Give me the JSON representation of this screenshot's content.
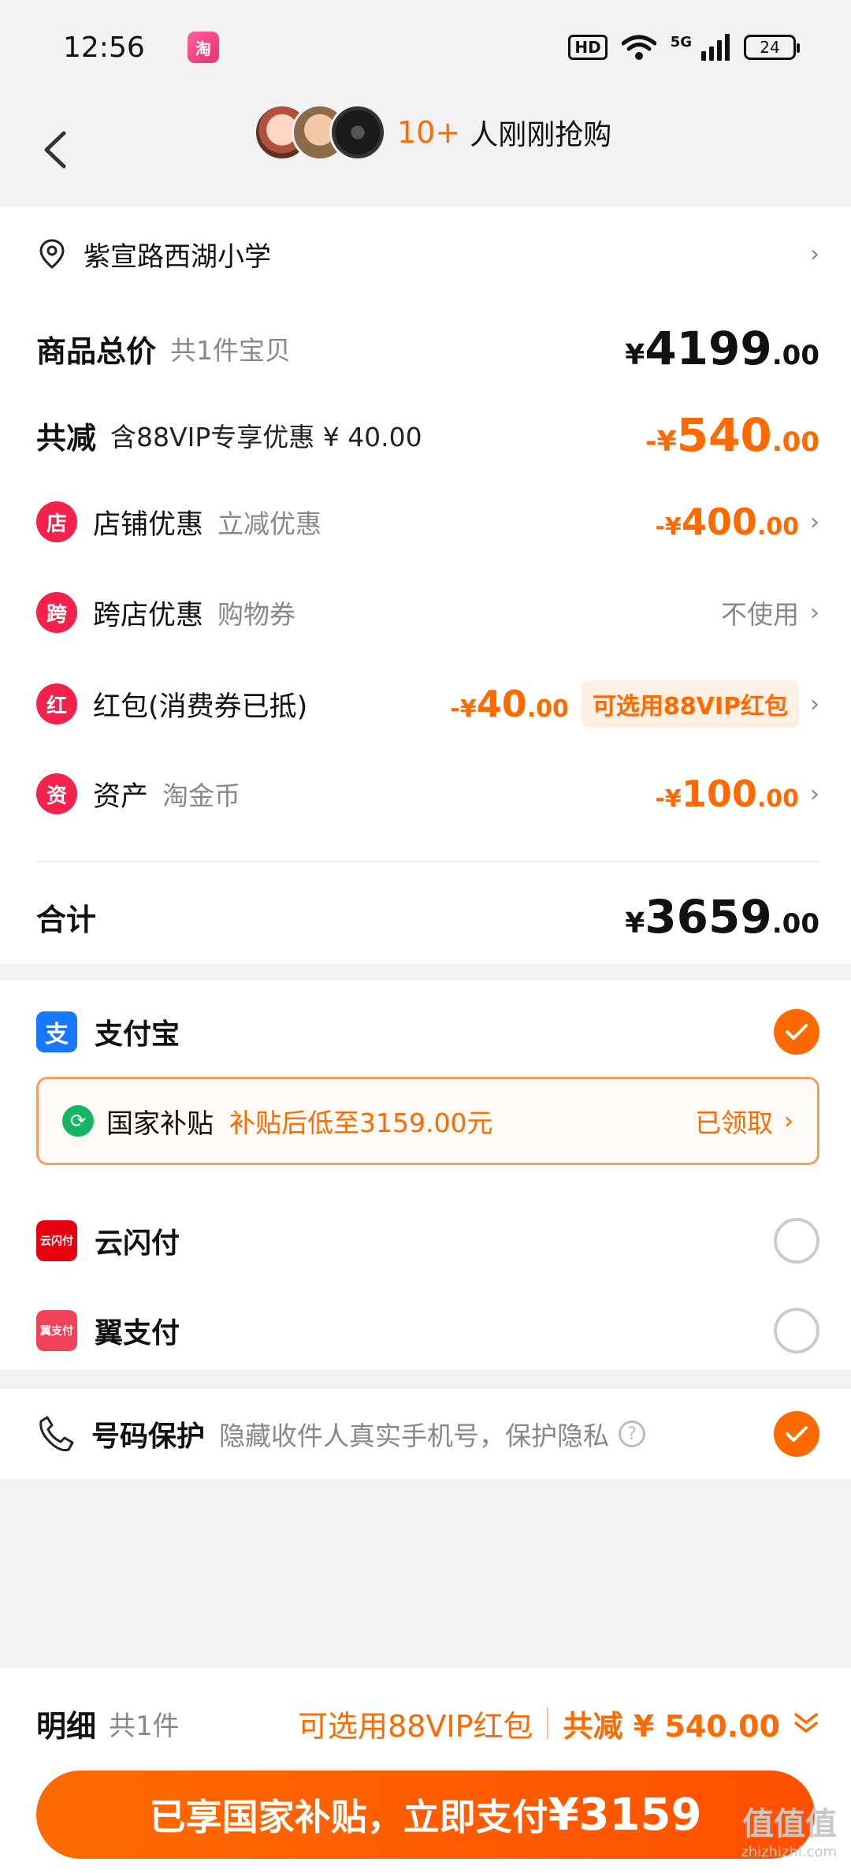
{
  "status_bar": {
    "time": "12:56",
    "app_icon_label": "淘",
    "hd": "HD",
    "network": "5G",
    "battery": "24"
  },
  "header": {
    "count": "10+",
    "text": "人刚刚抢购"
  },
  "address": {
    "text": "紫宣路西湖小学"
  },
  "summary": {
    "total_label": "商品总价",
    "total_sub": "共1件宝贝",
    "total_cur": "¥",
    "total_int": "4199",
    "total_dec": ".00",
    "reduce_label": "共减",
    "reduce_sub": "含88VIP专享优惠 ¥ 40.00",
    "reduce_cur": "-¥",
    "reduce_int": "540",
    "reduce_dec": ".00"
  },
  "discounts": [
    {
      "icon": "店",
      "label": "店铺优惠",
      "sub": "立减优惠",
      "cur": "-¥",
      "int": "400",
      "dec": ".00"
    },
    {
      "icon": "跨",
      "label": "跨店优惠",
      "sub": "购物券",
      "value": "不使用"
    },
    {
      "icon": "红",
      "label": "红包(消费券已抵)",
      "cur": "-¥",
      "int": "40",
      "dec": ".00",
      "tag": "可选用88VIP红包"
    },
    {
      "icon": "资",
      "label": "资产",
      "sub": "淘金币",
      "cur": "-¥",
      "int": "100",
      "dec": ".00"
    }
  ],
  "sum": {
    "label": "合计",
    "cur": "¥",
    "int": "3659",
    "dec": ".00"
  },
  "payment": {
    "alipay": {
      "icon": "支",
      "label": "支付宝",
      "selected": true
    },
    "subsidy": {
      "title": "国家补贴",
      "desc": "补贴后低至3159.00元",
      "status": "已领取"
    },
    "yunshanfu": {
      "icon": "云闪付",
      "label": "云闪付",
      "selected": false
    },
    "yizhifu": {
      "icon": "翼支付",
      "label": "翼支付",
      "selected": false
    }
  },
  "privacy": {
    "label": "号码保护",
    "desc": "隐藏收件人真实手机号，保护隐私",
    "help": "?"
  },
  "bottom": {
    "detail_label": "明细",
    "detail_count": "共1件",
    "vip": "可选用88VIP红包",
    "reduce": "共减 ¥ 540.00",
    "pay_text": "已享国家补贴，立即支付",
    "pay_amount": "¥3159"
  },
  "watermark": {
    "text": "值值值",
    "sub": "zhizhizhi.com"
  },
  "colors": {
    "accent": "#ff6a00",
    "red_icon": "#f2224c",
    "alipay": "#1677ff",
    "subsidy_green": "#16b566"
  }
}
